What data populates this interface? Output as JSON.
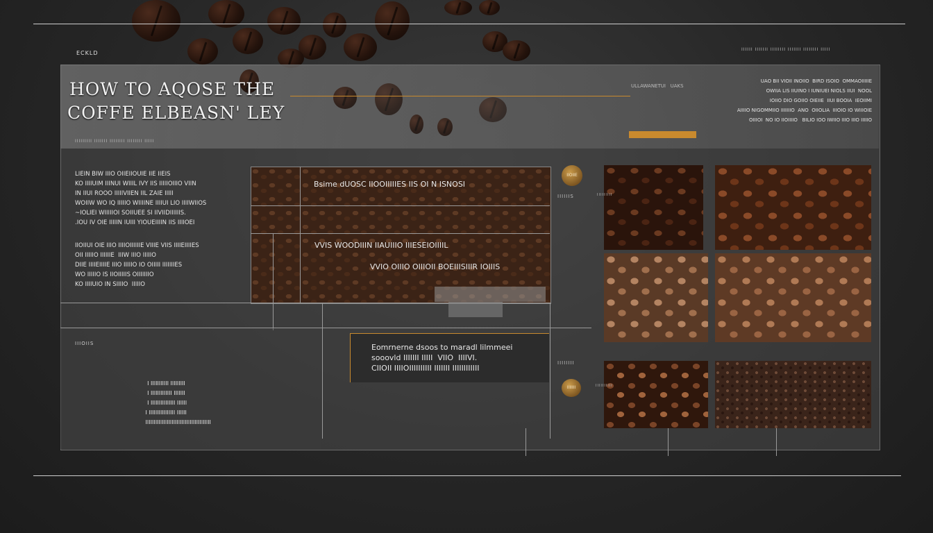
{
  "header": {
    "tag": "ECKLD",
    "meta_right": "IIIIII IIIIIII IIIIIIII IIIIIII IIIIIIII IIIII"
  },
  "hero": {
    "title_line1": "HOW TO AQOSE THE",
    "title_line2": "COFFE ELBEASN' LEY",
    "caption": "IIIIIIIII IIIIIII IIIIIIII IIIIIIII IIIII",
    "side_label": "ULLAWANETUI   UAKS",
    "side_text": "UAO BII VIOII INOIIO  BIRD ISOIO  OMMAOIIIIIE\nOWIIA LIS IIUINO I IUNIUEI NIOLS IIUI  NOOL\nIOIIO DIO GOIIO OIEIIE  IIUI BOOIA  IEOIIMI\nAIIIIO NIGOMMIIO IIIIIIIO  ANO  OIIOLIA  IIIOIO IO WIIIOIE\nOIIIOI  NO IO IIOIIIIO   BILIO IOO IWIIO IIIO IIIO IIIIIO",
    "accent_color": "#c98a2e"
  },
  "intro_block": {
    "para1": "LIEIN BIW IIIO OIIEIIOUIE IIE IIEIS\nKO IIIIUIM IIINUI WIIIL IVY IIS IIIIIOIIIO VIIN\nIN IIUI ROOO IIIIIVIIEN IIL ZAIE IIIII\nWOIIW WO IQ IIIIIO WIIIINE IIIIUI LIO IIIIWIIOS\n~IOLIEI WIIIIIOI SOIIUEE SI IIVIIDIIIIIIS.\n.IOU IV OIE IIIIIN IUIII YIOUEIIIIN IIS IIIIOEI",
    "para2": "IIOIIUI OIE IIIO IIIIOIIIIIIE VIIIE VIIS IIIIEIIIIES\nOII IIIIIO IIIIIIE  IIIW IIIO IIIIIO\nDIIE IIIIEIIIIE IIIO IIIIIO IO OIIIII IIIIIIIES\nWO IIIIIO IS IIOIIIIIS OIIIIIIIO\nKO IIIIUIO IN SIIIIO  IIIIIO"
  },
  "grid_block": {
    "line1": "Bsime dUOSC IIOOIIIIIES IIS OI N ISNOSI",
    "line2": "VVIS WOODIIIN IIAUIIIO IIIESEIOIIIIL",
    "line3": "VVIO OIIIO OIIIOII BOEIIISIIIR IOIIIS"
  },
  "note_block": {
    "text": "Eomrnerne dsoos to maradl lilmmeei\nsooovld IIIIIII IIIII  VIIO  IIIIVI.\nCIIOII IIIIOIIIIIIIIII IIIIIII IIIIIIIIIIII"
  },
  "lower_left": {
    "tag": "IIIOIIS",
    "list": "  I IIIIIIIIIII IIIIIIIII\n  I IIIIIIIIIIIII IIIIIII\n  I IIIIIIIIIIIIIII IIIIII\n I IIIIIIIIIIIIIIII IIIIII\n IIIIIIIIIIIIIIIIIIIIIIIIIIIIIIIIIIIIIIII"
  },
  "badges": {
    "b1": "IIOIIE",
    "b1_label": "IIIIIIS",
    "b2_label": "IIIIIIII",
    "b3": "IIIIIII"
  },
  "gallery": {
    "label_a": "IIIIIIIII",
    "label_b": "IIIIIIIIII"
  }
}
